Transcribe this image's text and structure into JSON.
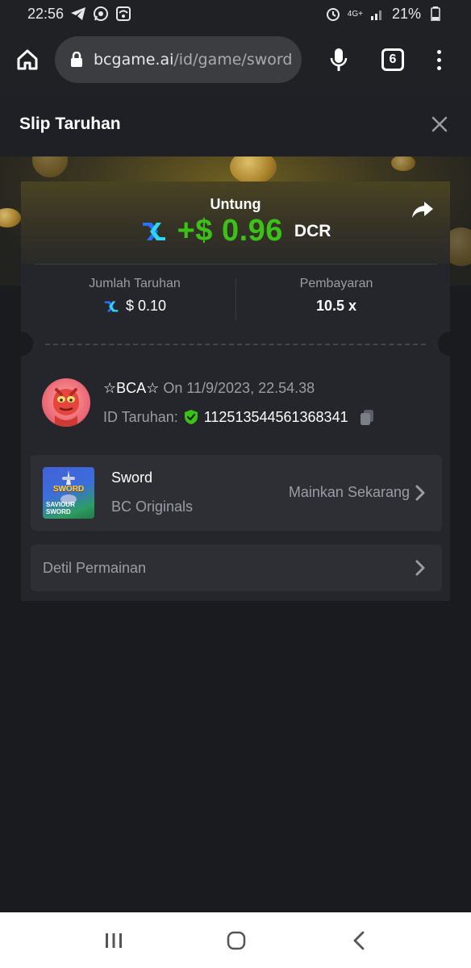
{
  "status_bar": {
    "time": "22:56",
    "network": "4G+",
    "battery": "21%"
  },
  "browser": {
    "url_domain": "bcgame.ai",
    "url_path": "/id/game/sword",
    "tab_count": "6"
  },
  "modal": {
    "title": "Slip Taruhan"
  },
  "bet": {
    "profit_label": "Untung",
    "profit_value": "+$ 0.96",
    "profit_currency": "DCR",
    "amount_label": "Jumlah Taruhan",
    "amount_value": "$ 0.10",
    "payout_label": "Pembayaran",
    "payout_value": "10.5 x",
    "username": "☆BCA☆",
    "timestamp": "On 11/9/2023, 22.54.38",
    "bet_id_label": "ID Taruhan:",
    "bet_id": "112513544561368341"
  },
  "game": {
    "name": "Sword",
    "provider": "BC Originals",
    "play_label": "Mainkan Sekarang",
    "thumb_title": "SWORD",
    "thumb_subtitle": "SAVIOUR SWORD"
  },
  "details": {
    "label": "Detil Permainan"
  },
  "colors": {
    "profit_green": "#3bc117",
    "shield_green": "#3bc117",
    "dcr_blue": "#2ed6f3"
  },
  "icons": {
    "home": "home-icon",
    "lock": "lock-icon",
    "mic": "microphone-icon",
    "menu": "more-vert-icon",
    "close": "close-icon",
    "share": "share-icon",
    "currency": "dcr-coin-icon",
    "shield": "verified-shield-icon",
    "copy": "copy-icon",
    "chevron": "chevron-right-icon"
  }
}
